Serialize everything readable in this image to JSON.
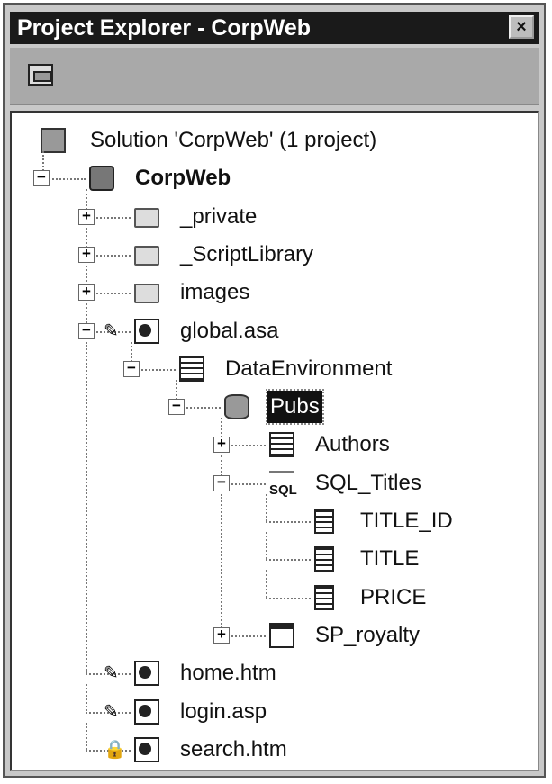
{
  "window": {
    "title": "Project Explorer - CorpWeb",
    "close_label": "×"
  },
  "toolbar": {
    "buttons": [
      {
        "icon": "view-object-icon"
      }
    ]
  },
  "tree": [
    {
      "label": "Solution 'CorpWeb' (1 project)",
      "level": 0,
      "expander": "none",
      "icon": "solution"
    },
    {
      "label": "CorpWeb",
      "level": 1,
      "expander": "-",
      "icon": "project",
      "bold": true
    },
    {
      "label": "_private",
      "level": 2,
      "expander": "+",
      "icon": "folder"
    },
    {
      "label": "_ScriptLibrary",
      "level": 2,
      "expander": "+",
      "icon": "folder"
    },
    {
      "label": "images",
      "level": 2,
      "expander": "+",
      "icon": "folder"
    },
    {
      "label": "global.asa",
      "level": 2,
      "expander": "-",
      "icon": "asp",
      "prefix": "pencil"
    },
    {
      "label": "DataEnvironment",
      "level": 3,
      "expander": "-",
      "icon": "grid"
    },
    {
      "label": "Pubs",
      "level": 4,
      "expander": "-",
      "icon": "db",
      "selected": true
    },
    {
      "label": "Authors",
      "level": 5,
      "expander": "+",
      "icon": "grid"
    },
    {
      "label": "SQL_Titles",
      "level": 5,
      "expander": "-",
      "icon": "sql"
    },
    {
      "label": "TITLE_ID",
      "level": 6,
      "expander": "none",
      "icon": "field"
    },
    {
      "label": "TITLE",
      "level": 6,
      "expander": "none",
      "icon": "field"
    },
    {
      "label": "PRICE",
      "level": 6,
      "expander": "none",
      "icon": "field"
    },
    {
      "label": "SP_royalty",
      "level": 5,
      "expander": "+",
      "icon": "proc"
    },
    {
      "label": "home.htm",
      "level": 2,
      "expander": "none",
      "icon": "doc",
      "prefix": "pencil"
    },
    {
      "label": "login.asp",
      "level": 2,
      "expander": "none",
      "icon": "asp",
      "prefix": "pencil"
    },
    {
      "label": "search.htm",
      "level": 2,
      "expander": "none",
      "icon": "doc",
      "prefix": "lock"
    }
  ],
  "sql_icon_text": "SQL"
}
